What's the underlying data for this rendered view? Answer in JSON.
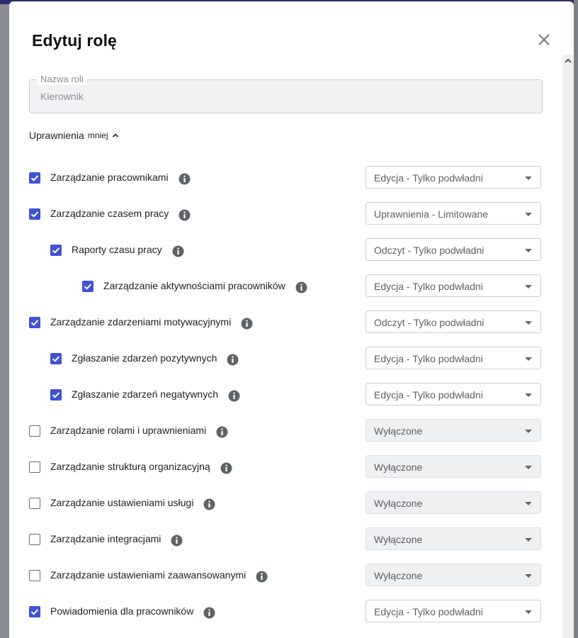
{
  "dialog": {
    "title": "Edytuj rolę",
    "close_icon": "close-icon"
  },
  "role_name": {
    "legend": "Nazwa roli",
    "value": "Kierownik"
  },
  "permissions": {
    "header": "Uprawnienia",
    "toggle_label": "mniej",
    "toggle_icon": "chevron-up-icon",
    "items": [
      {
        "label": "Zarządzanie pracownikami",
        "checked": true,
        "level": 0,
        "access": "Edycja - Tylko podwładni",
        "disabled": false
      },
      {
        "label": "Zarządzanie czasem pracy",
        "checked": true,
        "level": 0,
        "access": "Uprawnienia - Limitowane",
        "disabled": false
      },
      {
        "label": "Raporty czasu pracy",
        "checked": true,
        "level": 1,
        "access": "Odczyt - Tylko podwładni",
        "disabled": false
      },
      {
        "label": "Zarządzanie aktywnościami pracowników",
        "checked": true,
        "level": 2,
        "access": "Edycja - Tylko podwładni",
        "disabled": false
      },
      {
        "label": "Zarządzanie zdarzeniami motywacyjnymi",
        "checked": true,
        "level": 0,
        "access": "Odczyt - Tylko podwładni",
        "disabled": false
      },
      {
        "label": "Zgłaszanie zdarzeń pozytywnych",
        "checked": true,
        "level": 1,
        "access": "Edycja - Tylko podwładni",
        "disabled": false
      },
      {
        "label": "Zgłaszanie zdarzeń negatywnych",
        "checked": true,
        "level": 1,
        "access": "Edycja - Tylko podwładni",
        "disabled": false
      },
      {
        "label": "Zarządzanie rolami i uprawnieniami",
        "checked": false,
        "level": 0,
        "access": "Wyłączone",
        "disabled": true
      },
      {
        "label": "Zarządzanie strukturą organizacyjną",
        "checked": false,
        "level": 0,
        "access": "Wyłączone",
        "disabled": true
      },
      {
        "label": "Zarządzanie ustawieniami usługi",
        "checked": false,
        "level": 0,
        "access": "Wyłączone",
        "disabled": true
      },
      {
        "label": "Zarządzanie integracjami",
        "checked": false,
        "level": 0,
        "access": "Wyłączone",
        "disabled": true
      },
      {
        "label": "Zarządzanie ustawieniami zaawansowanymi",
        "checked": false,
        "level": 0,
        "access": "Wyłączone",
        "disabled": true
      },
      {
        "label": "Powiadomienia dla pracowników",
        "checked": true,
        "level": 0,
        "access": "Edycja - Tylko podwładni",
        "disabled": false
      }
    ]
  },
  "colors": {
    "checkbox_accent": "#4052d6",
    "disabled_select_bg": "#eff0f1"
  }
}
